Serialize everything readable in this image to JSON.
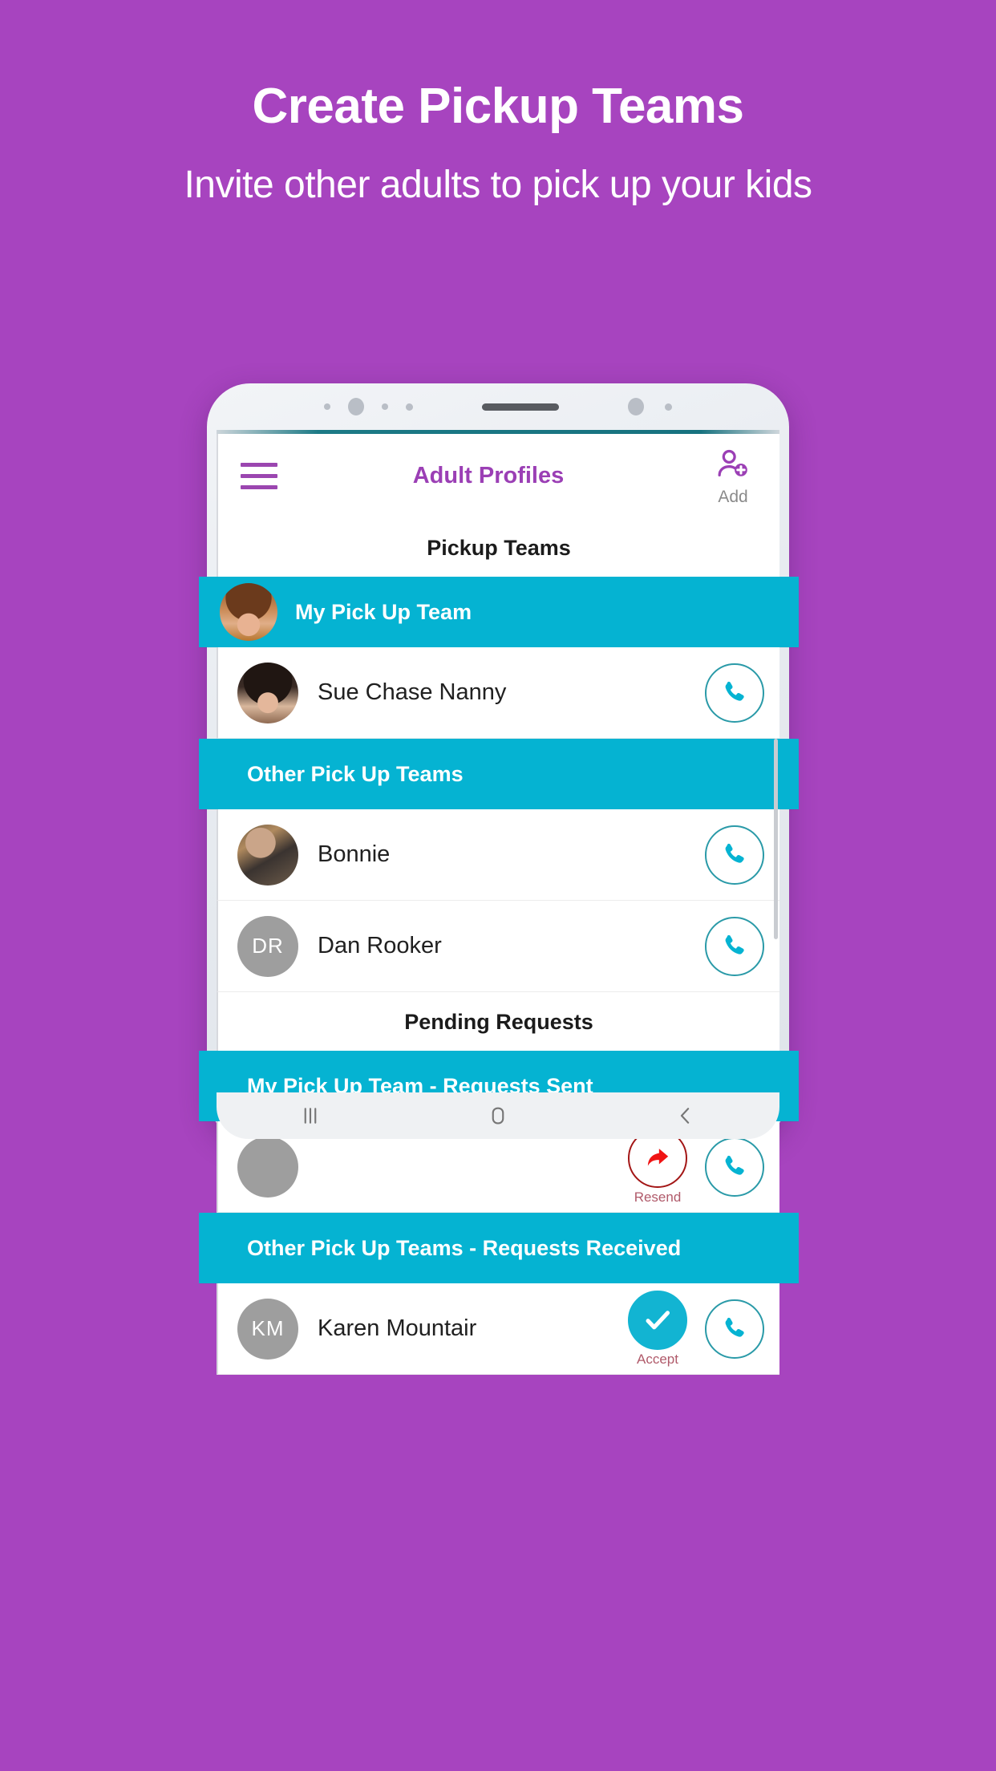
{
  "promo": {
    "title": "Create Pickup Teams",
    "subtitle": "Invite other adults to pick up your kids",
    "background_color": "#a744bf",
    "text_color": "#ffffff"
  },
  "phone": {
    "app": {
      "appbar": {
        "menu_icon": "hamburger-menu-icon",
        "title": "Adult Profiles",
        "title_color": "#9b3fb5",
        "add_icon": "person-add-icon",
        "add_label": "Add"
      },
      "accent_teal": "#05b3d2",
      "sections": [
        {
          "heading": "Pickup Teams",
          "groups": [
            {
              "band_label": "My Pick Up Team",
              "band_has_avatar": true,
              "band_avatar": "photo-woman-blonde",
              "rows": [
                {
                  "name": "Sue Chase Nanny",
                  "avatar_type": "photo",
                  "avatar": "photo-woman-dark-hair",
                  "initials": "",
                  "actions": [
                    {
                      "icon": "phone-call-icon",
                      "label": "",
                      "style": "phone-outline"
                    }
                  ]
                }
              ]
            },
            {
              "band_label": "Other Pick Up Teams",
              "band_has_avatar": false,
              "band_avatar": "",
              "rows": [
                {
                  "name": "Bonnie",
                  "avatar_type": "photo",
                  "avatar": "photo-dog",
                  "initials": "",
                  "actions": [
                    {
                      "icon": "phone-call-icon",
                      "label": "",
                      "style": "phone-outline"
                    }
                  ]
                },
                {
                  "name": "Dan Rooker",
                  "avatar_type": "initials",
                  "avatar": "",
                  "initials": "DR",
                  "actions": [
                    {
                      "icon": "phone-call-icon",
                      "label": "",
                      "style": "phone-outline"
                    }
                  ]
                }
              ]
            }
          ]
        },
        {
          "heading": "Pending Requests",
          "groups": [
            {
              "band_label": "My Pick Up Team - Requests Sent",
              "band_has_avatar": false,
              "band_avatar": "",
              "rows": [
                {
                  "name": "",
                  "avatar_type": "blank",
                  "avatar": "",
                  "initials": "",
                  "actions": [
                    {
                      "icon": "resend-arrow-icon",
                      "label": "Resend",
                      "style": "resend-outline"
                    },
                    {
                      "icon": "phone-call-icon",
                      "label": "",
                      "style": "phone-outline"
                    }
                  ]
                }
              ]
            },
            {
              "band_label": "Other Pick Up Teams - Requests Received",
              "band_has_avatar": false,
              "band_avatar": "",
              "rows": [
                {
                  "name": "Karen Mountair",
                  "avatar_type": "initials",
                  "avatar": "",
                  "initials": "KM",
                  "actions": [
                    {
                      "icon": "check-accept-icon",
                      "label": "Accept",
                      "style": "accept-filled"
                    },
                    {
                      "icon": "phone-call-icon",
                      "label": "",
                      "style": "phone-outline"
                    }
                  ]
                }
              ]
            }
          ]
        }
      ]
    },
    "nav": {
      "recents_icon": "recents-icon",
      "home_icon": "home-icon",
      "back_icon": "back-icon"
    }
  }
}
